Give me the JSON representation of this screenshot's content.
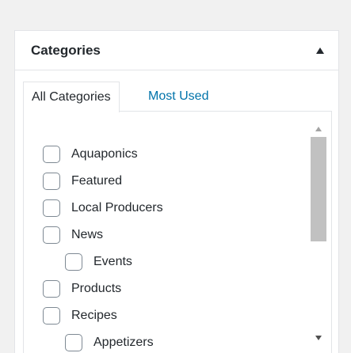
{
  "metabox": {
    "title": "Categories",
    "toggle_icon": "triangle-up-icon"
  },
  "tabs": [
    {
      "label": "All Categories",
      "active": true
    },
    {
      "label": "Most Used",
      "active": false
    }
  ],
  "categories": [
    {
      "label": "Aquaponics",
      "checked": false,
      "level": 0
    },
    {
      "label": "Featured",
      "checked": false,
      "level": 0
    },
    {
      "label": "Local Producers",
      "checked": false,
      "level": 0
    },
    {
      "label": "News",
      "checked": false,
      "level": 0
    },
    {
      "label": "Events",
      "checked": false,
      "level": 1
    },
    {
      "label": "Products",
      "checked": false,
      "level": 0
    },
    {
      "label": "Recipes",
      "checked": false,
      "level": 0
    },
    {
      "label": "Appetizers",
      "checked": false,
      "level": 1
    }
  ],
  "colors": {
    "link": "#0073aa",
    "border": "#e2e4e7",
    "scroll_thumb": "#c1c1c1",
    "checkbox_border": "#7e8993"
  }
}
